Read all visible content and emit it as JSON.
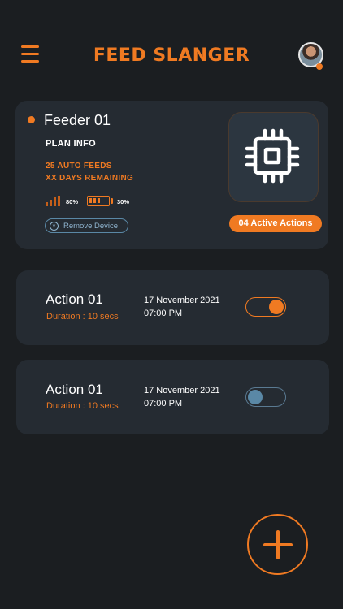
{
  "header": {
    "brand": "FEED SLANGER",
    "menu_icon": "hamburger-menu-icon",
    "avatar_icon": "user-avatar"
  },
  "feeder": {
    "name": "Feeder 01",
    "plan_info": "PLAN INFO",
    "auto_feeds": "25 AUTO FEEDS",
    "days_remaining": "XX DAYS REMAINING",
    "signal_pct": "80%",
    "battery_pct": "30%",
    "remove_label": "Remove Device",
    "active_actions": "04 Active Actions",
    "device_icon": "cpu-chip-icon"
  },
  "actions": [
    {
      "title": "Action 01",
      "duration": "Duration : 10 secs",
      "date": "17 November 2021",
      "time": "07:00 PM",
      "enabled": true
    },
    {
      "title": "Action 01",
      "duration": "Duration : 10 secs",
      "date": "17 November 2021",
      "time": "07:00 PM",
      "enabled": false
    }
  ],
  "colors": {
    "accent": "#f07a22",
    "background": "#1b1e21",
    "card": "#252b32",
    "muted_blue": "#5a88a6"
  }
}
